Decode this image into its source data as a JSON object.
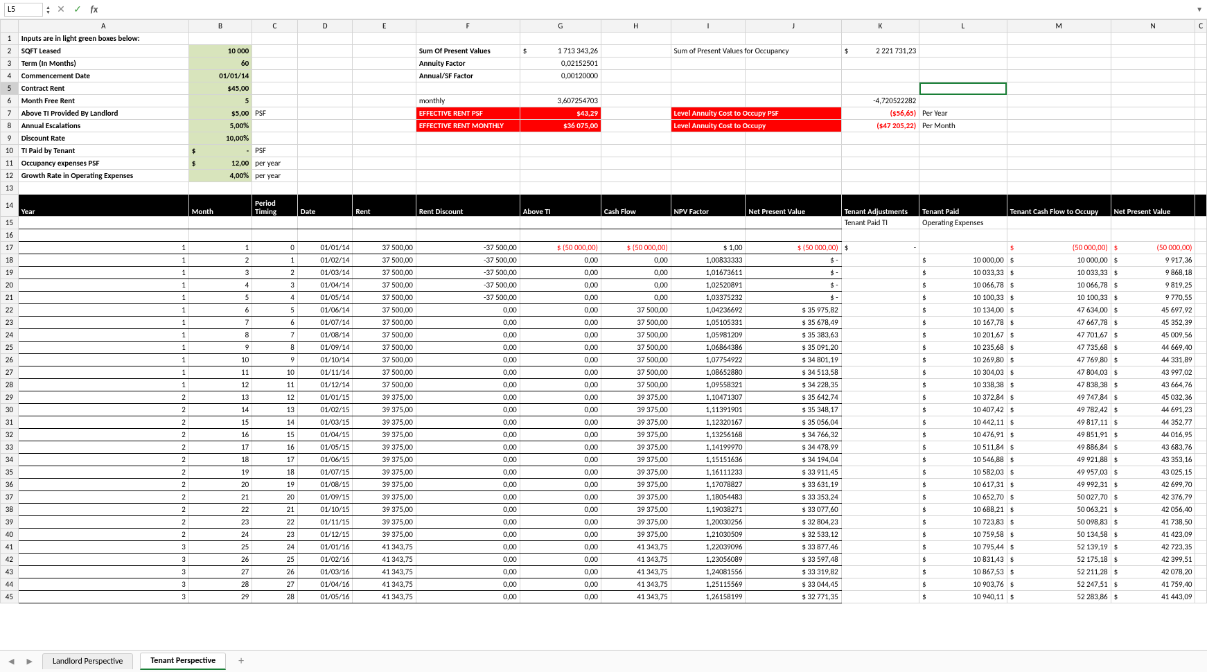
{
  "namebox": "L5",
  "tabs": {
    "prev": "◀",
    "next": "▶",
    "t1": "Landlord Perspective",
    "t2": "Tenant Perspective"
  },
  "cols": [
    "",
    "A",
    "B",
    "C",
    "D",
    "E",
    "F",
    "G",
    "H",
    "I",
    "J",
    "K",
    "L",
    "M",
    "N",
    "C"
  ],
  "inputs_header": "Inputs are in light green boxes below:",
  "labels": {
    "sqft": "SQFT Leased",
    "term": "Term (In Months)",
    "comm": "Commencement Date",
    "contract": "Contract Rent",
    "mfree": "Month Free Rent",
    "aboveTI": "Above TI Provided By Landlord",
    "esc": "Annual Escalations",
    "disc": "Discount Rate",
    "tipaid": "TI Paid by Tenant",
    "occ": "Occupancy expenses PSF",
    "grow": "Growth Rate in Operating Expenses",
    "spv": "Sum Of Present Values",
    "ann": "Annuity Factor",
    "asf": "Annual/SF Factor",
    "mon": "monthly",
    "erpsf": "EFFECTIVE RENT PSF",
    "erm": "EFFECTIVE RENT MONTHLY",
    "spvocc": "Sum of Present Values for Occupancy",
    "lacpsf": "Level Annuity Cost to Occupy PSF",
    "lac": "Level Annuity Cost to Occupy",
    "peryr": "Per Year",
    "permo": "Per Month",
    "psf": "PSF",
    "py": "per year"
  },
  "vals": {
    "sqft": "10 000",
    "term": "60",
    "comm": "01/01/14",
    "contract": "$45,00",
    "mfree": "5",
    "aboveTI": "$5,00",
    "esc": "5,00%",
    "disc": "10,00%",
    "tipaidC": "$",
    "tipaid": "-",
    "occC": "$",
    "occ": "12,00",
    "grow": "4,00%",
    "spvC": "$",
    "spv": "1 713 343,26",
    "ann": "0,02152501",
    "asf": "0,00120000",
    "mon": "3,607254703",
    "erpsf": "$43,29",
    "erm": "$36 075,00",
    "spvoccC": "$",
    "spvocc": "2 221 731,23",
    "neg": "-4,720522282",
    "lacpsf": "($56,65)",
    "lac": "($47 205,22)"
  },
  "hdrs": {
    "year": "Year",
    "month": "Month",
    "period": "Period Timing",
    "date": "Date",
    "rent": "Rent",
    "rdisc": "Rent Discount",
    "above": "Above TI",
    "cf": "Cash Flow",
    "npvf": "NPV Factor",
    "npv": "Net Present Value",
    "tadj": "Tenant Adjustments",
    "tpaid": "Tenant Paid",
    "tcfo": "Tenant Cash Flow to Occupy",
    "npv2": "Net Present Value",
    "tpti": "Tenant Paid TI",
    "opex": "Operating Expenses"
  },
  "rows": [
    {
      "r": 17,
      "y": 1,
      "m": 1,
      "p": 0,
      "d": "01/01/14",
      "rent": "37 500,00",
      "rd": "-37 500,00",
      "ati": "$    (50 000,00)",
      "cf": "$    (50 000,00)",
      "nf": "$          1,00",
      "npv": "$               (50 000,00)",
      "tadjC": "$",
      "tadj": "-",
      "tp": "",
      "tpC": "",
      "tcC": "$",
      "tcfo": "(50 000,00)",
      "n2C": "$",
      "n2": "(50 000,00)"
    },
    {
      "r": 18,
      "y": 1,
      "m": 2,
      "p": 1,
      "d": "01/02/14",
      "rent": "37 500,00",
      "rd": "-37 500,00",
      "ati": "0,00",
      "cf": "0,00",
      "nf": "1,00833333",
      "npv": "$                              -",
      "tpC": "$",
      "tp": "10 000,00",
      "tcC": "$",
      "tcfo": "10 000,00",
      "n2C": "$",
      "n2": "9 917,36"
    },
    {
      "r": 19,
      "y": 1,
      "m": 3,
      "p": 2,
      "d": "01/03/14",
      "rent": "37 500,00",
      "rd": "-37 500,00",
      "ati": "0,00",
      "cf": "0,00",
      "nf": "1,01673611",
      "npv": "$                              -",
      "tpC": "$",
      "tp": "10 033,33",
      "tcC": "$",
      "tcfo": "10 033,33",
      "n2C": "$",
      "n2": "9 868,18"
    },
    {
      "r": 20,
      "y": 1,
      "m": 4,
      "p": 3,
      "d": "01/04/14",
      "rent": "37 500,00",
      "rd": "-37 500,00",
      "ati": "0,00",
      "cf": "0,00",
      "nf": "1,02520891",
      "npv": "$                              -",
      "tpC": "$",
      "tp": "10 066,78",
      "tcC": "$",
      "tcfo": "10 066,78",
      "n2C": "$",
      "n2": "9 819,25"
    },
    {
      "r": 21,
      "y": 1,
      "m": 5,
      "p": 4,
      "d": "01/05/14",
      "rent": "37 500,00",
      "rd": "-37 500,00",
      "ati": "0,00",
      "cf": "0,00",
      "nf": "1,03375232",
      "npv": "$                              -",
      "tpC": "$",
      "tp": "10 100,33",
      "tcC": "$",
      "tcfo": "10 100,33",
      "n2C": "$",
      "n2": "9 770,55"
    },
    {
      "r": 22,
      "y": 1,
      "m": 6,
      "p": 5,
      "d": "01/06/14",
      "rent": "37 500,00",
      "rd": "0,00",
      "ati": "0,00",
      "cf": "37 500,00",
      "nf": "1,04236692",
      "npv": "$                   35 975,82",
      "tpC": "$",
      "tp": "10 134,00",
      "tcC": "$",
      "tcfo": "47 634,00",
      "n2C": "$",
      "n2": "45 697,92"
    },
    {
      "r": 23,
      "y": 1,
      "m": 7,
      "p": 6,
      "d": "01/07/14",
      "rent": "37 500,00",
      "rd": "0,00",
      "ati": "0,00",
      "cf": "37 500,00",
      "nf": "1,05105331",
      "npv": "$                   35 678,49",
      "tpC": "$",
      "tp": "10 167,78",
      "tcC": "$",
      "tcfo": "47 667,78",
      "n2C": "$",
      "n2": "45 352,39"
    },
    {
      "r": 24,
      "y": 1,
      "m": 8,
      "p": 7,
      "d": "01/08/14",
      "rent": "37 500,00",
      "rd": "0,00",
      "ati": "0,00",
      "cf": "37 500,00",
      "nf": "1,05981209",
      "npv": "$                   35 383,63",
      "tpC": "$",
      "tp": "10 201,67",
      "tcC": "$",
      "tcfo": "47 701,67",
      "n2C": "$",
      "n2": "45 009,56"
    },
    {
      "r": 25,
      "y": 1,
      "m": 9,
      "p": 8,
      "d": "01/09/14",
      "rent": "37 500,00",
      "rd": "0,00",
      "ati": "0,00",
      "cf": "37 500,00",
      "nf": "1,06864386",
      "npv": "$                   35 091,20",
      "tpC": "$",
      "tp": "10 235,68",
      "tcC": "$",
      "tcfo": "47 735,68",
      "n2C": "$",
      "n2": "44 669,40"
    },
    {
      "r": 26,
      "y": 1,
      "m": 10,
      "p": 9,
      "d": "01/10/14",
      "rent": "37 500,00",
      "rd": "0,00",
      "ati": "0,00",
      "cf": "37 500,00",
      "nf": "1,07754922",
      "npv": "$                   34 801,19",
      "tpC": "$",
      "tp": "10 269,80",
      "tcC": "$",
      "tcfo": "47 769,80",
      "n2C": "$",
      "n2": "44 331,89"
    },
    {
      "r": 27,
      "y": 1,
      "m": 11,
      "p": 10,
      "d": "01/11/14",
      "rent": "37 500,00",
      "rd": "0,00",
      "ati": "0,00",
      "cf": "37 500,00",
      "nf": "1,08652880",
      "npv": "$                   34 513,58",
      "tpC": "$",
      "tp": "10 304,03",
      "tcC": "$",
      "tcfo": "47 804,03",
      "n2C": "$",
      "n2": "43 997,02"
    },
    {
      "r": 28,
      "y": 1,
      "m": 12,
      "p": 11,
      "d": "01/12/14",
      "rent": "37 500,00",
      "rd": "0,00",
      "ati": "0,00",
      "cf": "37 500,00",
      "nf": "1,09558321",
      "npv": "$                   34 228,35",
      "tpC": "$",
      "tp": "10 338,38",
      "tcC": "$",
      "tcfo": "47 838,38",
      "n2C": "$",
      "n2": "43 664,76"
    },
    {
      "r": 29,
      "y": 2,
      "m": 13,
      "p": 12,
      "d": "01/01/15",
      "rent": "39 375,00",
      "rd": "0,00",
      "ati": "0,00",
      "cf": "39 375,00",
      "nf": "1,10471307",
      "npv": "$                   35 642,74",
      "tpC": "$",
      "tp": "10 372,84",
      "tcC": "$",
      "tcfo": "49 747,84",
      "n2C": "$",
      "n2": "45 032,36"
    },
    {
      "r": 30,
      "y": 2,
      "m": 14,
      "p": 13,
      "d": "01/02/15",
      "rent": "39 375,00",
      "rd": "0,00",
      "ati": "0,00",
      "cf": "39 375,00",
      "nf": "1,11391901",
      "npv": "$                   35 348,17",
      "tpC": "$",
      "tp": "10 407,42",
      "tcC": "$",
      "tcfo": "49 782,42",
      "n2C": "$",
      "n2": "44 691,23"
    },
    {
      "r": 31,
      "y": 2,
      "m": 15,
      "p": 14,
      "d": "01/03/15",
      "rent": "39 375,00",
      "rd": "0,00",
      "ati": "0,00",
      "cf": "39 375,00",
      "nf": "1,12320167",
      "npv": "$                   35 056,04",
      "tpC": "$",
      "tp": "10 442,11",
      "tcC": "$",
      "tcfo": "49 817,11",
      "n2C": "$",
      "n2": "44 352,77"
    },
    {
      "r": 32,
      "y": 2,
      "m": 16,
      "p": 15,
      "d": "01/04/15",
      "rent": "39 375,00",
      "rd": "0,00",
      "ati": "0,00",
      "cf": "39 375,00",
      "nf": "1,13256168",
      "npv": "$                   34 766,32",
      "tpC": "$",
      "tp": "10 476,91",
      "tcC": "$",
      "tcfo": "49 851,91",
      "n2C": "$",
      "n2": "44 016,95"
    },
    {
      "r": 33,
      "y": 2,
      "m": 17,
      "p": 16,
      "d": "01/05/15",
      "rent": "39 375,00",
      "rd": "0,00",
      "ati": "0,00",
      "cf": "39 375,00",
      "nf": "1,14199970",
      "npv": "$                   34 478,99",
      "tpC": "$",
      "tp": "10 511,84",
      "tcC": "$",
      "tcfo": "49 886,84",
      "n2C": "$",
      "n2": "43 683,76"
    },
    {
      "r": 34,
      "y": 2,
      "m": 18,
      "p": 17,
      "d": "01/06/15",
      "rent": "39 375,00",
      "rd": "0,00",
      "ati": "0,00",
      "cf": "39 375,00",
      "nf": "1,15151636",
      "npv": "$                   34 194,04",
      "tpC": "$",
      "tp": "10 546,88",
      "tcC": "$",
      "tcfo": "49 921,88",
      "n2C": "$",
      "n2": "43 353,16"
    },
    {
      "r": 35,
      "y": 2,
      "m": 19,
      "p": 18,
      "d": "01/07/15",
      "rent": "39 375,00",
      "rd": "0,00",
      "ati": "0,00",
      "cf": "39 375,00",
      "nf": "1,16111233",
      "npv": "$                   33 911,45",
      "tpC": "$",
      "tp": "10 582,03",
      "tcC": "$",
      "tcfo": "49 957,03",
      "n2C": "$",
      "n2": "43 025,15"
    },
    {
      "r": 36,
      "y": 2,
      "m": 20,
      "p": 19,
      "d": "01/08/15",
      "rent": "39 375,00",
      "rd": "0,00",
      "ati": "0,00",
      "cf": "39 375,00",
      "nf": "1,17078827",
      "npv": "$                   33 631,19",
      "tpC": "$",
      "tp": "10 617,31",
      "tcC": "$",
      "tcfo": "49 992,31",
      "n2C": "$",
      "n2": "42 699,70"
    },
    {
      "r": 37,
      "y": 2,
      "m": 21,
      "p": 20,
      "d": "01/09/15",
      "rent": "39 375,00",
      "rd": "0,00",
      "ati": "0,00",
      "cf": "39 375,00",
      "nf": "1,18054483",
      "npv": "$                   33 353,24",
      "tpC": "$",
      "tp": "10 652,70",
      "tcC": "$",
      "tcfo": "50 027,70",
      "n2C": "$",
      "n2": "42 376,79"
    },
    {
      "r": 38,
      "y": 2,
      "m": 22,
      "p": 21,
      "d": "01/10/15",
      "rent": "39 375,00",
      "rd": "0,00",
      "ati": "0,00",
      "cf": "39 375,00",
      "nf": "1,19038271",
      "npv": "$                   33 077,60",
      "tpC": "$",
      "tp": "10 688,21",
      "tcC": "$",
      "tcfo": "50 063,21",
      "n2C": "$",
      "n2": "42 056,40"
    },
    {
      "r": 39,
      "y": 2,
      "m": 23,
      "p": 22,
      "d": "01/11/15",
      "rent": "39 375,00",
      "rd": "0,00",
      "ati": "0,00",
      "cf": "39 375,00",
      "nf": "1,20030256",
      "npv": "$                   32 804,23",
      "tpC": "$",
      "tp": "10 723,83",
      "tcC": "$",
      "tcfo": "50 098,83",
      "n2C": "$",
      "n2": "41 738,50"
    },
    {
      "r": 40,
      "y": 2,
      "m": 24,
      "p": 23,
      "d": "01/12/15",
      "rent": "39 375,00",
      "rd": "0,00",
      "ati": "0,00",
      "cf": "39 375,00",
      "nf": "1,21030509",
      "npv": "$                   32 533,12",
      "tpC": "$",
      "tp": "10 759,58",
      "tcC": "$",
      "tcfo": "50 134,58",
      "n2C": "$",
      "n2": "41 423,09"
    },
    {
      "r": 41,
      "y": 3,
      "m": 25,
      "p": 24,
      "d": "01/01/16",
      "rent": "41 343,75",
      "rd": "0,00",
      "ati": "0,00",
      "cf": "41 343,75",
      "nf": "1,22039096",
      "npv": "$                   33 877,46",
      "tpC": "$",
      "tp": "10 795,44",
      "tcC": "$",
      "tcfo": "52 139,19",
      "n2C": "$",
      "n2": "42 723,35"
    },
    {
      "r": 42,
      "y": 3,
      "m": 26,
      "p": 25,
      "d": "01/02/16",
      "rent": "41 343,75",
      "rd": "0,00",
      "ati": "0,00",
      "cf": "41 343,75",
      "nf": "1,23056089",
      "npv": "$                   33 597,48",
      "tpC": "$",
      "tp": "10 831,43",
      "tcC": "$",
      "tcfo": "52 175,18",
      "n2C": "$",
      "n2": "42 399,51"
    },
    {
      "r": 43,
      "y": 3,
      "m": 27,
      "p": 26,
      "d": "01/03/16",
      "rent": "41 343,75",
      "rd": "0,00",
      "ati": "0,00",
      "cf": "41 343,75",
      "nf": "1,24081556",
      "npv": "$                   33 319,82",
      "tpC": "$",
      "tp": "10 867,53",
      "tcC": "$",
      "tcfo": "52 211,28",
      "n2C": "$",
      "n2": "42 078,20"
    },
    {
      "r": 44,
      "y": 3,
      "m": 28,
      "p": 27,
      "d": "01/04/16",
      "rent": "41 343,75",
      "rd": "0,00",
      "ati": "0,00",
      "cf": "41 343,75",
      "nf": "1,25115569",
      "npv": "$                   33 044,45",
      "tpC": "$",
      "tp": "10 903,76",
      "tcC": "$",
      "tcfo": "52 247,51",
      "n2C": "$",
      "n2": "41 759,40"
    },
    {
      "r": 45,
      "y": 3,
      "m": 29,
      "p": 28,
      "d": "01/05/16",
      "rent": "41 343,75",
      "rd": "0,00",
      "ati": "0,00",
      "cf": "41 343,75",
      "nf": "1,26158199",
      "npv": "$                   32 771,35",
      "tpC": "$",
      "tp": "10 940,11",
      "tcC": "$",
      "tcfo": "52 283,86",
      "n2C": "$",
      "n2": "41 443,09"
    }
  ]
}
